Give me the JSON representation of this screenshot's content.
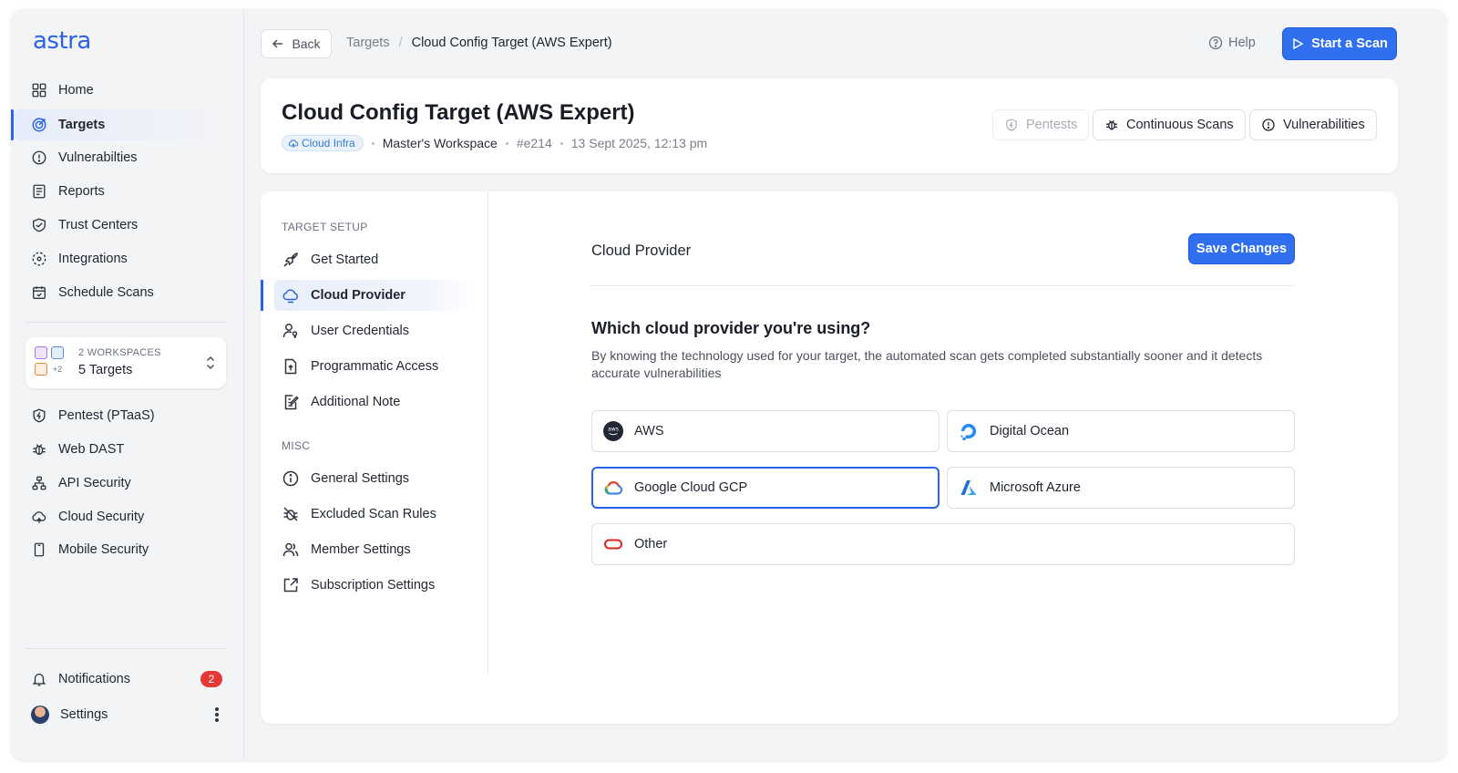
{
  "app": {
    "logo_text": "astra"
  },
  "sidebar": {
    "items": [
      {
        "label": "Home",
        "icon": "grid-icon"
      },
      {
        "label": "Targets",
        "icon": "target-icon",
        "active": true
      },
      {
        "label": "Vulnerabilties",
        "icon": "alert-circle-icon"
      },
      {
        "label": "Reports",
        "icon": "report-icon"
      },
      {
        "label": "Trust Centers",
        "icon": "handshake-icon"
      },
      {
        "label": "Integrations",
        "icon": "integrations-icon"
      },
      {
        "label": "Schedule Scans",
        "icon": "calendar-icon"
      }
    ],
    "workspace": {
      "label": "2 WORKSPACES",
      "value": "5 Targets",
      "extra_count": "+2"
    },
    "products": [
      {
        "label": "Pentest (PTaaS)",
        "icon": "shield-icon"
      },
      {
        "label": "Web DAST",
        "icon": "bug-icon"
      },
      {
        "label": "API Security",
        "icon": "network-icon"
      },
      {
        "label": "Cloud Security",
        "icon": "cloud-icon"
      },
      {
        "label": "Mobile Security",
        "icon": "mobile-icon"
      }
    ],
    "notifications": {
      "label": "Notifications",
      "count": "2"
    },
    "settings": {
      "label": "Settings"
    }
  },
  "topbar": {
    "back_label": "Back",
    "breadcrumb": {
      "parent": "Targets",
      "separator": "/",
      "current": "Cloud Config Target (AWS Expert)"
    },
    "help_label": "Help",
    "start_scan_label": "Start a Scan"
  },
  "header": {
    "title": "Cloud Config Target (AWS Expert)",
    "tag": "Cloud Infra",
    "workspace": "Master's Workspace",
    "id": "#e214",
    "timestamp": "13 Sept 2025, 12:13 pm",
    "buttons": {
      "pentests": "Pentests",
      "continuous_scans": "Continuous Scans",
      "vulnerabilities": "Vulnerabilities"
    }
  },
  "subnav": {
    "setup_label": "TARGET SETUP",
    "setup_items": [
      {
        "label": "Get Started",
        "icon": "rocket-icon"
      },
      {
        "label": "Cloud Provider",
        "icon": "cloud-icon",
        "active": true
      },
      {
        "label": "User Credentials",
        "icon": "user-key-icon"
      },
      {
        "label": "Programmatic Access",
        "icon": "file-upload-icon"
      },
      {
        "label": "Additional Note",
        "icon": "note-edit-icon"
      }
    ],
    "misc_label": "MISC",
    "misc_items": [
      {
        "label": "General Settings",
        "icon": "info-icon"
      },
      {
        "label": "Excluded Scan Rules",
        "icon": "bug-off-icon"
      },
      {
        "label": "Member Settings",
        "icon": "users-icon"
      },
      {
        "label": "Subscription Settings",
        "icon": "external-link-icon"
      }
    ]
  },
  "content": {
    "section_title": "Cloud Provider",
    "save_label": "Save Changes",
    "question": "Which cloud provider you're using?",
    "description": "By knowing the technology used for your target, the automated scan gets completed substantially sooner and it detects accurate vulnerabilities",
    "options": [
      {
        "label": "AWS",
        "icon": "aws-icon"
      },
      {
        "label": "Digital Ocean",
        "icon": "digital-ocean-icon"
      },
      {
        "label": "Google Cloud GCP",
        "icon": "gcp-icon",
        "selected": true
      },
      {
        "label": "Microsoft Azure",
        "icon": "azure-icon"
      },
      {
        "label": "Other",
        "icon": "oracle-icon"
      }
    ]
  },
  "colors": {
    "accent": "#2f6ff0",
    "badge": "#e53935",
    "tag_bg": "#e9f2fb",
    "tag_text": "#3a7bd5"
  }
}
